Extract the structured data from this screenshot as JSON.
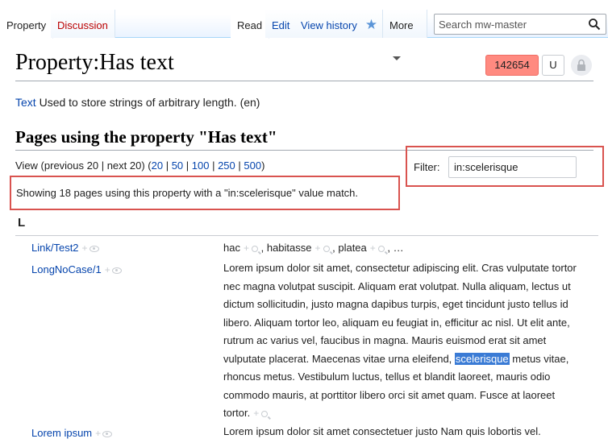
{
  "tabs": {
    "left": [
      {
        "label": "Property",
        "active": true
      },
      {
        "label": "Discussion",
        "active": false
      }
    ],
    "right": [
      {
        "label": "Read",
        "active": true
      },
      {
        "label": "Edit",
        "active": false
      },
      {
        "label": "View history",
        "active": false
      }
    ],
    "more_label": "More",
    "watch_icon": "star-icon"
  },
  "search": {
    "placeholder": "Search mw-master",
    "icon": "search-icon"
  },
  "page": {
    "title": "Property:Has text"
  },
  "indicators": {
    "count": "142654",
    "u": "U",
    "lock_icon": "lock-icon"
  },
  "description": {
    "type_link": "Text",
    "text": " Used to store strings of arbitrary length. (en)"
  },
  "section": {
    "heading": "Pages using the property \"Has text\""
  },
  "view_nav": {
    "prefix": "View (previous 20  |  next 20) (",
    "options": [
      "20",
      "50",
      "100",
      "250",
      "500"
    ],
    "suffix": ")"
  },
  "filter": {
    "label": "Filter:",
    "value": "in:scelerisque"
  },
  "showing": {
    "text": "Showing 18 pages using this property with a \"in:scelerisque\" value match."
  },
  "letter": "L",
  "rows": [
    {
      "name": "Link/Test2",
      "values_pre": "hac",
      "values_list": [
        ", habitasse",
        ", platea",
        ", …"
      ]
    },
    {
      "name": "LongNoCase/1",
      "text_before": "Lorem ipsum dolor sit amet, consectetur adipiscing elit. Cras vulputate tortor nec magna volutpat suscipit. Aliquam erat volutpat. Nulla aliquam, lectus ut dictum sollicitudin, justo magna dapibus turpis, eget tincidunt justo tellus id libero. Aliquam tortor leo, aliquam eu feugiat in, efficitur ac nisl. Ut elit ante, rutrum ac varius vel, faucibus in magna. Mauris euismod erat sit amet vulputate placerat. Maecenas vitae urna eleifend, ",
      "highlight": "scelerisque",
      "text_after": " metus vitae, rhoncus metus. Vestibulum luctus, tellus et blandit laoreet, mauris odio commodo mauris, at porttitor libero orci sit amet quam. Fusce at laoreet tortor."
    },
    {
      "name": "Lorem ipsum",
      "text_before": "Lorem ipsum dolor sit amet consectetuer justo Nam quis lobortis vel."
    }
  ],
  "colors": {
    "accent_link": "#0645ad",
    "red_link": "#ba0000",
    "highlight_box": "#d9534f",
    "count_badge": "#ff8a80",
    "selection": "#3a7bd5"
  }
}
